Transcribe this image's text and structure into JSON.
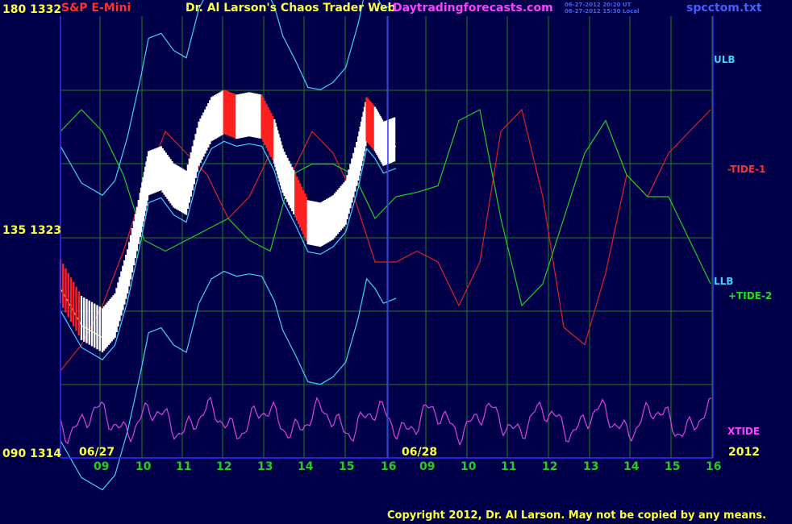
{
  "header": {
    "symbol": "S&P E-Mini",
    "title": "Dr. Al Larson's Chaos Trader Web",
    "site": "Daytradingforecasts.com",
    "stamp_ut": "06-27-2012 20:20 UT",
    "stamp_local": "06-27-2012 15:30 Local",
    "file": "spcctom.txt"
  },
  "y_labels": {
    "top": "180  1332",
    "mid": "135  1323",
    "bottom": "090  1314"
  },
  "right_labels": {
    "ulb": "ULB",
    "tide1": "-TIDE-1",
    "llb": "LLB",
    "tide2": "+TIDE-2",
    "xtide": "XTIDE"
  },
  "dates": {
    "d1": "06/27",
    "d2": "06/28",
    "year": "2012"
  },
  "copyright": "Copyright 2012, Dr. Al Larson. May not be copied by any means.",
  "colors": {
    "background": "#00004a",
    "grid": "#208020",
    "border": "#3030ff",
    "price": "#ffffff",
    "price_down": "#ff2020",
    "ma": "#ffff60",
    "bands": "#40d0ff",
    "tide1": "#e02020",
    "tide2": "#20d020",
    "xtide": "#e040e0"
  },
  "chart_data": {
    "type": "line",
    "title": "S&P E-Mini",
    "y_scale_left": {
      "ticks": [
        "1314",
        "1323",
        "1332"
      ],
      "range": [
        1314,
        1332
      ]
    },
    "x_hour_ticks": [
      "09",
      "10",
      "11",
      "12",
      "13",
      "14",
      "15",
      "16",
      "09",
      "10",
      "11",
      "12",
      "13",
      "14",
      "15",
      "16"
    ],
    "forecast_start": "06/28",
    "price": {
      "x_hours": [
        8.0,
        8.5,
        9.0,
        9.3,
        9.6,
        9.9,
        10.1,
        10.4,
        10.7,
        11.0,
        11.3,
        11.6,
        11.9,
        12.2,
        12.5,
        12.8,
        13.1,
        13.3,
        13.6,
        13.9,
        14.2,
        14.5,
        14.8,
        15.1,
        15.3,
        15.5,
        15.7,
        16.0
      ],
      "values": [
        1321.2,
        1319.7,
        1319.2,
        1319.8,
        1321.6,
        1323.9,
        1325.6,
        1325.8,
        1325.1,
        1324.8,
        1326.8,
        1327.8,
        1328.1,
        1327.9,
        1328.0,
        1327.9,
        1326.9,
        1325.7,
        1324.7,
        1323.6,
        1323.5,
        1323.8,
        1324.4,
        1326.2,
        1327.8,
        1327.4,
        1326.8,
        1327.0
      ]
    },
    "series": [
      {
        "name": "-TIDE-1",
        "points": [
          [
            8.0,
            40
          ],
          [
            8.5,
            52
          ],
          [
            9.0,
            70
          ],
          [
            9.5,
            95
          ],
          [
            10.0,
            125
          ],
          [
            10.5,
            150
          ],
          [
            11.0,
            140
          ],
          [
            11.5,
            130
          ],
          [
            12.0,
            110
          ],
          [
            12.5,
            120
          ],
          [
            13.0,
            140
          ],
          [
            13.5,
            130
          ],
          [
            14.0,
            150
          ],
          [
            14.5,
            140
          ],
          [
            15.0,
            120
          ],
          [
            15.5,
            90
          ],
          [
            16.0,
            90
          ],
          [
            16.5,
            95
          ],
          [
            17.0,
            90
          ],
          [
            17.5,
            70
          ],
          [
            18.0,
            90
          ],
          [
            18.5,
            150
          ],
          [
            19.0,
            160
          ],
          [
            19.5,
            120
          ],
          [
            20.0,
            60
          ],
          [
            20.5,
            52
          ],
          [
            21.0,
            85
          ],
          [
            21.5,
            130
          ],
          [
            22.0,
            120
          ],
          [
            22.5,
            140
          ],
          [
            23.0,
            150
          ],
          [
            23.5,
            160
          ]
        ]
      },
      {
        "name": "+TIDE-2",
        "points": [
          [
            8.0,
            150
          ],
          [
            8.5,
            160
          ],
          [
            9.0,
            150
          ],
          [
            9.5,
            130
          ],
          [
            10.0,
            100
          ],
          [
            10.5,
            95
          ],
          [
            11.0,
            100
          ],
          [
            11.5,
            105
          ],
          [
            12.0,
            110
          ],
          [
            12.5,
            100
          ],
          [
            13.0,
            95
          ],
          [
            13.5,
            130
          ],
          [
            14.0,
            135
          ],
          [
            14.5,
            135
          ],
          [
            15.0,
            130
          ],
          [
            15.5,
            110
          ],
          [
            16.0,
            120
          ],
          [
            16.5,
            122
          ],
          [
            17.0,
            125
          ],
          [
            17.5,
            155
          ],
          [
            18.0,
            160
          ],
          [
            18.5,
            110
          ],
          [
            19.0,
            70
          ],
          [
            19.5,
            80
          ],
          [
            20.0,
            110
          ],
          [
            20.5,
            140
          ],
          [
            21.0,
            155
          ],
          [
            21.5,
            130
          ],
          [
            22.0,
            120
          ],
          [
            22.5,
            120
          ],
          [
            23.0,
            100
          ],
          [
            23.5,
            80
          ]
        ]
      }
    ]
  }
}
